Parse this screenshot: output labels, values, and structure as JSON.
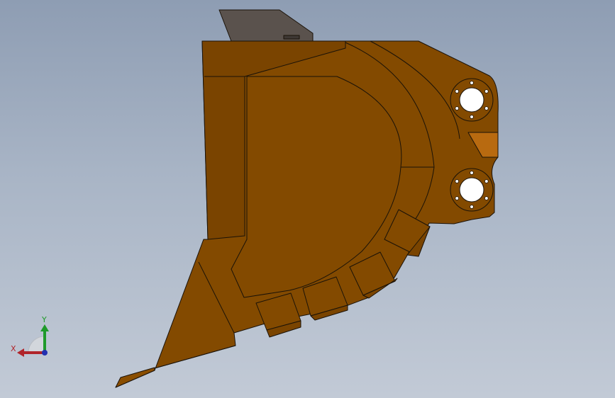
{
  "view": {
    "background_top": "#8e9db3",
    "background_bottom": "#c2cad6"
  },
  "model": {
    "body_color": "#834a00",
    "body_shade_color": "#7a4400",
    "bracket_color": "#5a524d",
    "pin_hole_fill": "#ffffff",
    "bolt_holes_per_boss": 6
  },
  "triad": {
    "x_label": "X",
    "y_label": "Y",
    "x_color": "#b0242a",
    "y_color": "#1f9a2a",
    "z_color": "#2230b0"
  }
}
